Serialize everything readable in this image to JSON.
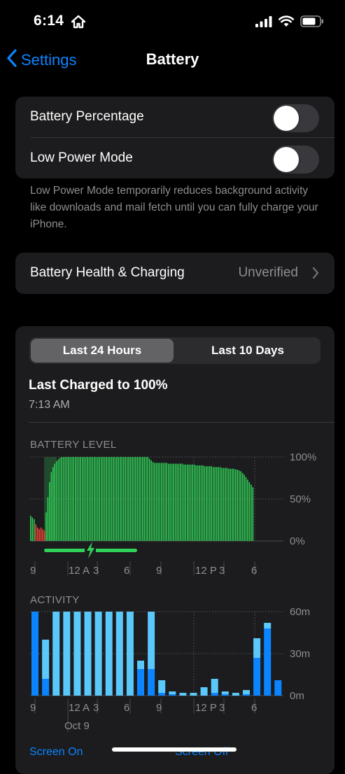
{
  "status_bar": {
    "time": "6:14",
    "icons": [
      "home-icon",
      "cellular-signal-icon",
      "wifi-icon",
      "battery-icon"
    ]
  },
  "nav": {
    "back_label": "Settings",
    "title": "Battery"
  },
  "settings": {
    "battery_percentage_label": "Battery Percentage",
    "battery_percentage_on": false,
    "low_power_label": "Low Power Mode",
    "low_power_on": false,
    "low_power_footnote": "Low Power Mode temporarily reduces background activity like downloads and mail fetch until you can fully charge your iPhone.",
    "health_label": "Battery Health & Charging",
    "health_value": "Unverified"
  },
  "usage": {
    "tabs": [
      "Last 24 Hours",
      "Last 10 Days"
    ],
    "selected_tab": "Last 24 Hours",
    "last_charged": "Last Charged to 100%",
    "last_charged_time": "7:13 AM"
  },
  "colors": {
    "accent": "#0a84ff",
    "battery_green": "#30d158",
    "battery_red": "#ff453a",
    "screen_on": "#0a84ff",
    "screen_off": "#5ac8fa"
  },
  "chart_data": [
    {
      "type": "bar",
      "title": "BATTERY LEVEL",
      "y_ticks": [
        "100%",
        "50%",
        "0%"
      ],
      "ylim": [
        0,
        100
      ],
      "x_ticks": [
        "9",
        "12 A",
        "3",
        "6",
        "9",
        "12 P",
        "3",
        "6"
      ],
      "charging_indicator": "charging-bolt-icon",
      "values": [
        30,
        28,
        26,
        20,
        16,
        14,
        16,
        14,
        12,
        34,
        52,
        70,
        82,
        88,
        92,
        95,
        97,
        99,
        100,
        100,
        100,
        100,
        100,
        100,
        100,
        100,
        100,
        100,
        100,
        100,
        100,
        100,
        100,
        100,
        100,
        100,
        100,
        100,
        100,
        100,
        100,
        100,
        100,
        100,
        100,
        100,
        100,
        100,
        100,
        100,
        100,
        100,
        100,
        100,
        100,
        100,
        100,
        100,
        100,
        100,
        100,
        100,
        100,
        100,
        100,
        100,
        100,
        100,
        100,
        98,
        96,
        94,
        93,
        93,
        93,
        93,
        93,
        93,
        93,
        93,
        92,
        92,
        92,
        92,
        92,
        92,
        92,
        92,
        92,
        91,
        91,
        91,
        91,
        91,
        91,
        91,
        90,
        90,
        90,
        90,
        90,
        89,
        89,
        89,
        89,
        89,
        88,
        88,
        88,
        88,
        88,
        87,
        87,
        87,
        87,
        86,
        86,
        86,
        86,
        85,
        85,
        84,
        83,
        81,
        79,
        76,
        73,
        70,
        67,
        64
      ],
      "low_threshold_index": 9
    },
    {
      "type": "bar",
      "title": "ACTIVITY",
      "y_ticks": [
        "60m",
        "30m",
        "0m"
      ],
      "ylim": [
        0,
        60
      ],
      "x_ticks": [
        "9",
        "12 A",
        "3",
        "6",
        "9",
        "12 P",
        "3",
        "6"
      ],
      "date_label": "Oct 9",
      "series": [
        {
          "name": "Screen On",
          "values": [
            60,
            12,
            0,
            0,
            0,
            0,
            0,
            0,
            0,
            0,
            19,
            19,
            2,
            1,
            0,
            0,
            0,
            2,
            1,
            0,
            1,
            27,
            48,
            11
          ]
        },
        {
          "name": "Screen Off",
          "values": [
            0,
            28,
            60,
            60,
            60,
            60,
            60,
            60,
            60,
            60,
            6,
            41,
            9,
            2,
            2,
            2,
            6,
            10,
            2,
            2,
            3,
            14,
            4,
            0
          ]
        }
      ]
    }
  ],
  "legend": {
    "screen_on": "Screen On",
    "screen_off": "Screen Off"
  }
}
